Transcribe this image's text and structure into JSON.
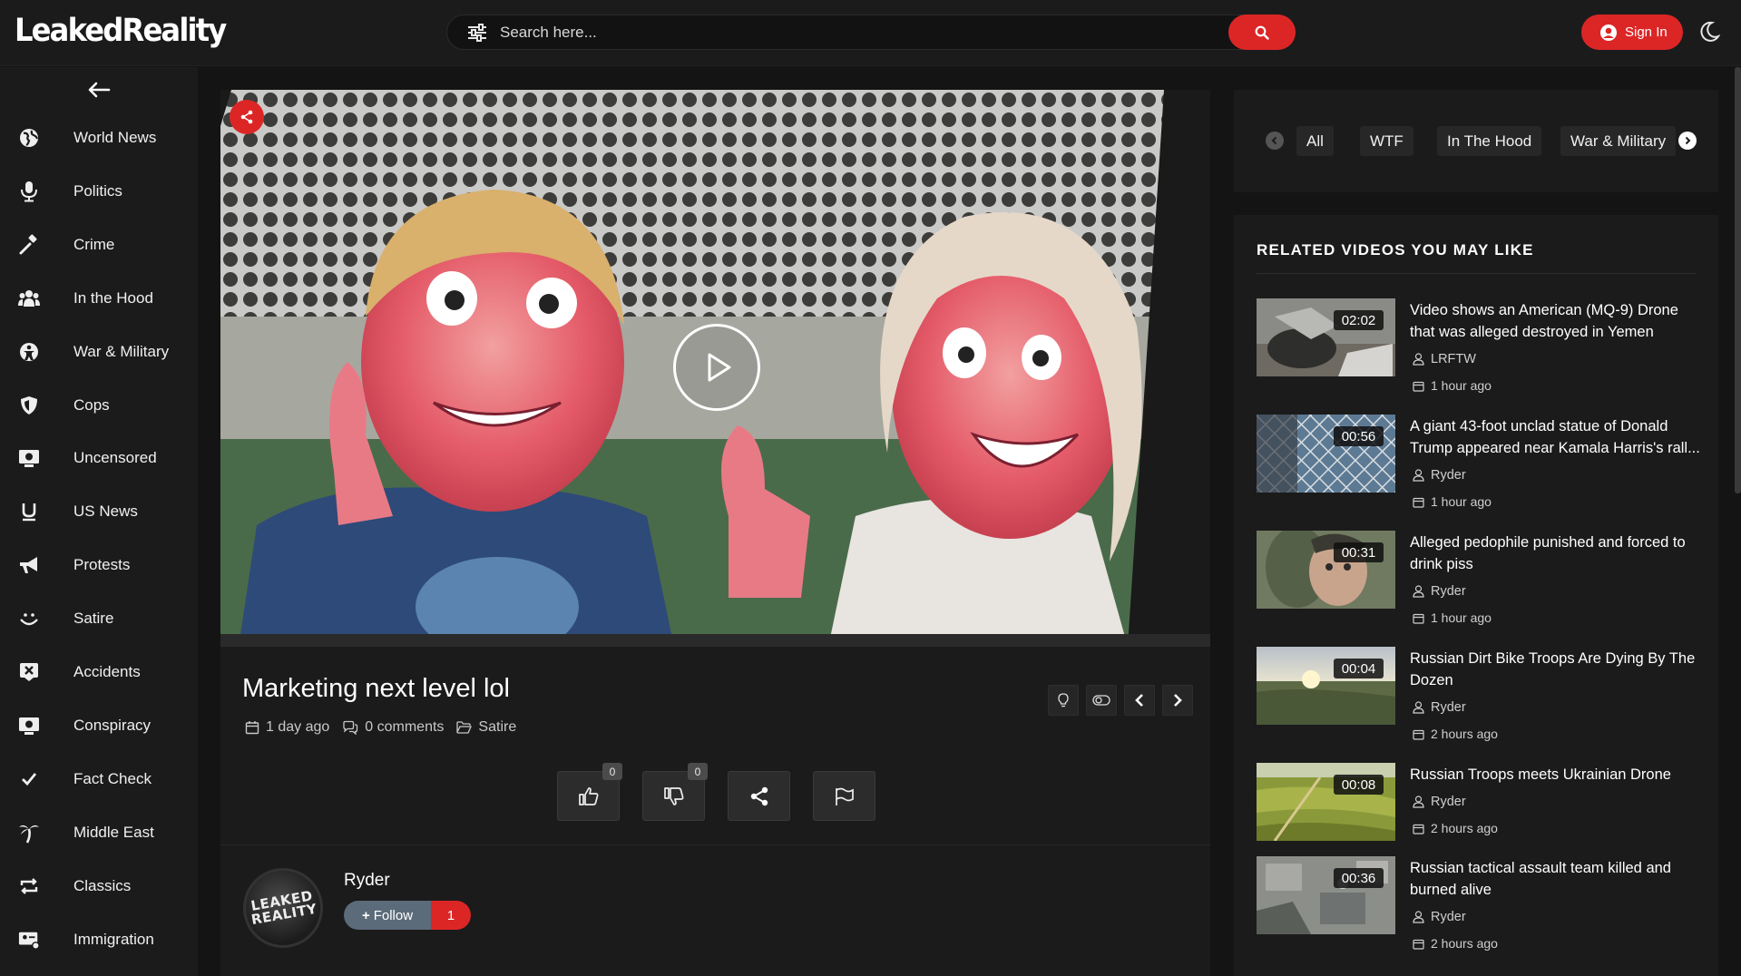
{
  "header": {
    "logo": "LeakedReality",
    "search_placeholder": "Search here...",
    "signin_label": "Sign In"
  },
  "sidebar": {
    "items": [
      {
        "label": "World News",
        "icon": "globe-icon"
      },
      {
        "label": "Politics",
        "icon": "microphone-icon"
      },
      {
        "label": "Crime",
        "icon": "gavel-icon"
      },
      {
        "label": "In the Hood",
        "icon": "group-icon"
      },
      {
        "label": "War & Military",
        "icon": "military-icon"
      },
      {
        "label": "Cops",
        "icon": "shield-icon"
      },
      {
        "label": "Uncensored",
        "icon": "screen-icon"
      },
      {
        "label": "US News",
        "icon": "u-letter-icon"
      },
      {
        "label": "Protests",
        "icon": "megaphone-icon"
      },
      {
        "label": "Satire",
        "icon": "smile-icon"
      },
      {
        "label": "Accidents",
        "icon": "car-crash-icon"
      },
      {
        "label": "Conspiracy",
        "icon": "eye-screen-icon"
      },
      {
        "label": "Fact Check",
        "icon": "check-icon"
      },
      {
        "label": "Middle East",
        "icon": "palm-tree-icon"
      },
      {
        "label": "Classics",
        "icon": "repeat-icon"
      },
      {
        "label": "Immigration",
        "icon": "id-card-icon"
      }
    ]
  },
  "video": {
    "title": "Marketing next level lol",
    "date": "1 day ago",
    "comments": "0 comments",
    "category": "Satire",
    "likes": "0",
    "dislikes": "0"
  },
  "author": {
    "name": "Ryder",
    "avatar_text": "LEAKED REALITY",
    "follow_label": "Follow",
    "followers": "1"
  },
  "categories": [
    "All",
    "WTF",
    "In The Hood",
    "War & Military"
  ],
  "related": {
    "heading": "RELATED VIDEOS YOU MAY LIKE",
    "items": [
      {
        "duration": "02:02",
        "title": "Video shows an American (MQ-9) Drone that was alleged destroyed in Yemen",
        "author": "LRFTW",
        "time": "1 hour ago"
      },
      {
        "duration": "00:56",
        "title": "A giant 43-foot unclad statue of Donald Trump appeared near Kamala Harris's rall...",
        "author": "Ryder",
        "time": "1 hour ago"
      },
      {
        "duration": "00:31",
        "title": "Alleged pedophile punished and forced to drink piss",
        "author": "Ryder",
        "time": "1 hour ago"
      },
      {
        "duration": "00:04",
        "title": "Russian Dirt Bike Troops Are Dying By The Dozen",
        "author": "Ryder",
        "time": "2 hours ago"
      },
      {
        "duration": "00:08",
        "title": "Russian Troops meets Ukrainian Drone",
        "author": "Ryder",
        "time": "2 hours ago"
      },
      {
        "duration": "00:36",
        "title": "Russian tactical assault team killed and burned alive",
        "author": "Ryder",
        "time": "2 hours ago"
      }
    ]
  },
  "colors": {
    "accent": "#dc2626",
    "background": "#141414",
    "panel": "#1b1b1b"
  }
}
